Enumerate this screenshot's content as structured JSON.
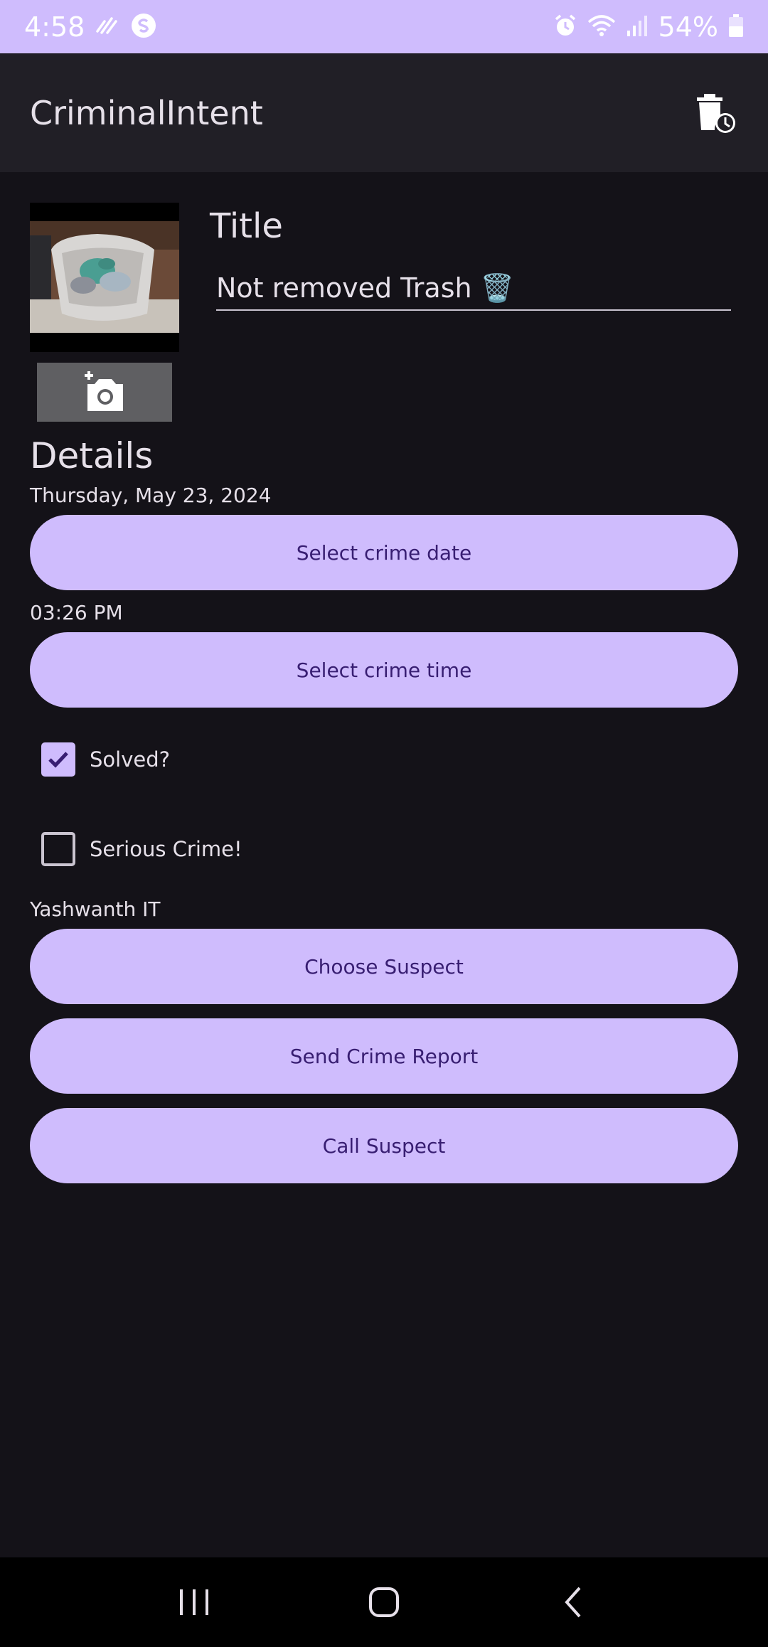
{
  "status_bar": {
    "time": "4:58",
    "battery": "54%",
    "icons": [
      "data-saver-icon",
      "shazam-icon",
      "alarm-icon",
      "wifi-icon",
      "signal-icon",
      "battery-icon"
    ]
  },
  "app_bar": {
    "title": "CriminalIntent",
    "action_icon": "delete-schedule-icon"
  },
  "crime": {
    "photo_icon": "crime-photo",
    "camera_icon": "add-photo-icon",
    "title_label": "Title",
    "title_value": "Not removed Trash 🗑️",
    "details_label": "Details",
    "date": "Thursday, May 23, 2024",
    "select_date_label": "Select crime date",
    "time": "03:26 PM",
    "select_time_label": "Select crime time",
    "solved_label": "Solved?",
    "solved_checked": true,
    "serious_label": "Serious Crime!",
    "serious_checked": false,
    "suspect_name": "Yashwanth IT",
    "choose_suspect_label": "Choose Suspect",
    "send_report_label": "Send Crime Report",
    "call_suspect_label": "Call Suspect"
  },
  "colors": {
    "accent": "#cfbcfd",
    "background": "#141218",
    "app_bar": "#211f26",
    "on_accent": "#381e72"
  },
  "nav_bar": {
    "icons": [
      "recents-icon",
      "home-icon",
      "back-icon"
    ]
  }
}
